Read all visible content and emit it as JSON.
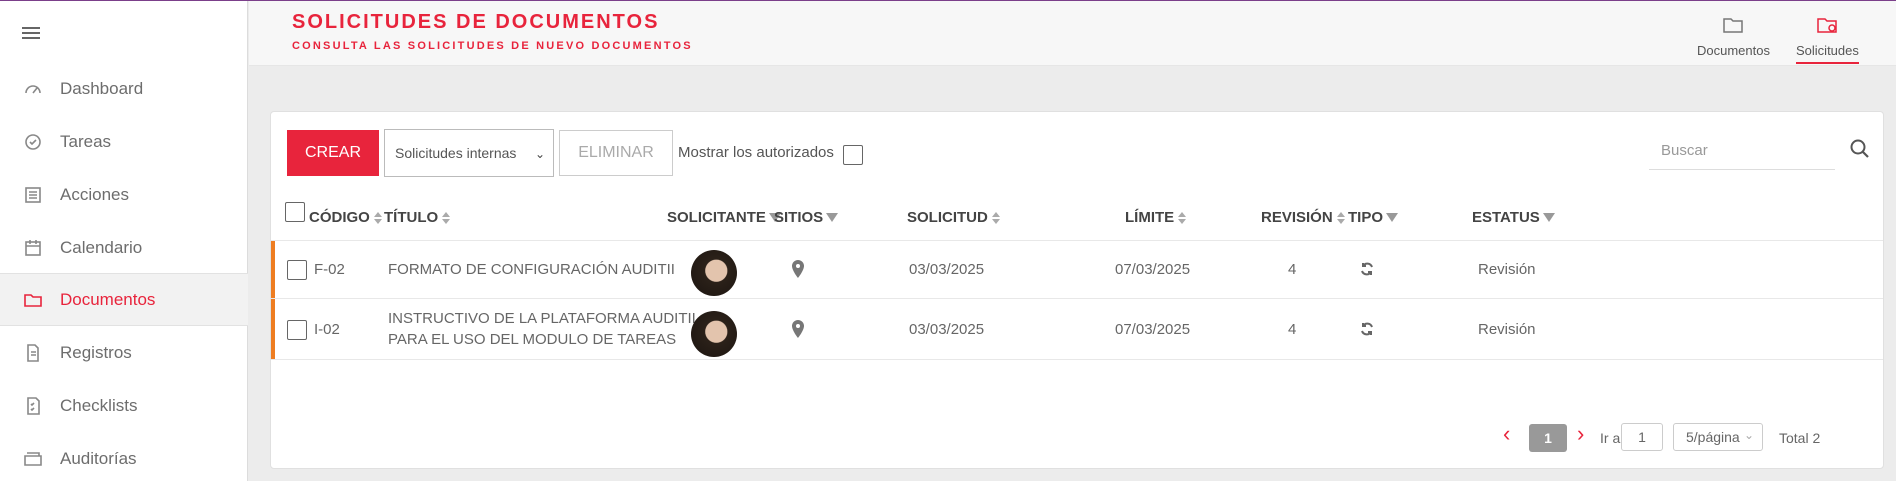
{
  "sidebar": {
    "items": [
      {
        "label": "Dashboard",
        "icon": "gauge-icon"
      },
      {
        "label": "Tareas",
        "icon": "check-circle-icon"
      },
      {
        "label": "Acciones",
        "icon": "list-icon"
      },
      {
        "label": "Calendario",
        "icon": "calendar-icon"
      },
      {
        "label": "Documentos",
        "icon": "folder-icon",
        "active": true
      },
      {
        "label": "Registros",
        "icon": "file-icon"
      },
      {
        "label": "Checklists",
        "icon": "checklist-icon"
      },
      {
        "label": "Auditorías",
        "icon": "archive-icon"
      }
    ]
  },
  "header": {
    "title": "SOLICITUDES DE DOCUMENTOS",
    "subtitle": "CONSULTA LAS SOLICITUDES DE NUEVO DOCUMENTOS",
    "tabs": [
      {
        "label": "Documentos",
        "icon": "folder-icon"
      },
      {
        "label": "Solicitudes",
        "icon": "folder-clock-icon",
        "active": true
      }
    ]
  },
  "toolbar": {
    "create_label": "CREAR",
    "select_value": "Solicitudes internas",
    "delete_label": "ELIMINAR",
    "toggle_label": "Mostrar los autorizados",
    "search_placeholder": "Buscar"
  },
  "table": {
    "columns": [
      "CÓDIGO",
      "TÍTULO",
      "SOLICITANTE",
      "SITIOS",
      "SOLICITUD",
      "LÍMITE",
      "REVISIÓN",
      "TIPO",
      "ESTATUS"
    ],
    "rows": [
      {
        "code": "F-02",
        "title1": "FORMATO DE CONFIGURACIÓN AUDITII",
        "title2": "",
        "request_date": "03/03/2025",
        "limit_date": "07/03/2025",
        "revision": "4",
        "status": "Revisión"
      },
      {
        "code": "I-02",
        "title1": "INSTRUCTIVO DE LA PLATAFORMA AUDITII,",
        "title2": "PARA EL USO DEL MODULO DE TAREAS",
        "request_date": "03/03/2025",
        "limit_date": "07/03/2025",
        "revision": "4",
        "status": "Revisión"
      }
    ]
  },
  "pagination": {
    "current_page": "1",
    "goto_label": "Ir a",
    "goto_value": "1",
    "page_size": "5/página",
    "total": "Total 2"
  },
  "colors": {
    "accent": "#e8243c",
    "row_marker": "#ee7d21"
  }
}
